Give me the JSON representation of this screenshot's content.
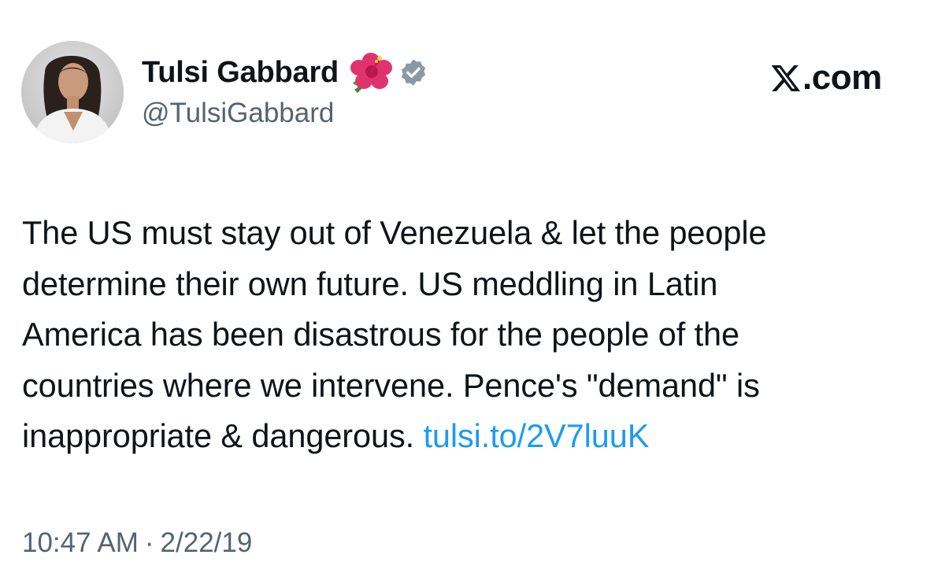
{
  "author": {
    "display_name": "Tulsi Gabbard",
    "handle": "@TulsiGabbard",
    "emoji": "hibiscus-flower",
    "verified_icon": "verified-badge-icon",
    "verified_color": "#8b98a5"
  },
  "brand": {
    "logo": "x-logo-icon",
    "text": ".com"
  },
  "tweet": {
    "lines": [
      "The US must stay out of Venezuela & let the people",
      "determine their own future. US meddling in Latin",
      "America has been disastrous for the people of the",
      "countries where we intervene. Pence's \"demand\" is",
      "inappropriate & dangerous. "
    ],
    "link_text": "tulsi.to/2V7luuK",
    "link_color": "#1d9bf0"
  },
  "meta": {
    "time": "10:47 AM",
    "separator": "·",
    "date": "2/22/19"
  }
}
